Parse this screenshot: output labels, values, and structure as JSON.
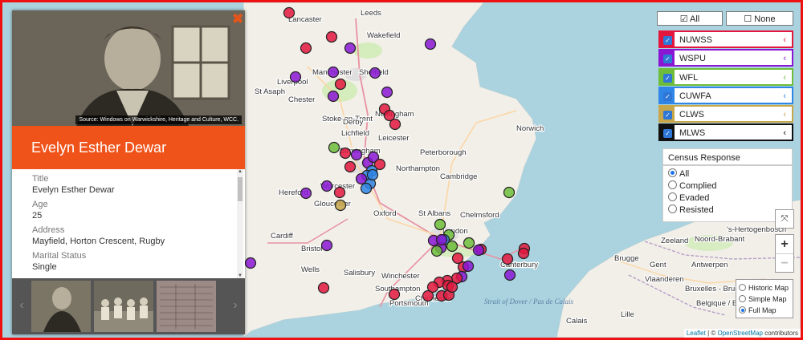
{
  "person": {
    "name": "Evelyn Esther Dewar",
    "photo_credit": "Source: Windows on Warwickshire, Heritage and Culture, WCC.",
    "close_icon": "close-x-icon",
    "fields": [
      {
        "label": "Title",
        "value": "Evelyn Esther Dewar"
      },
      {
        "label": "Age",
        "value": "25"
      },
      {
        "label": "Address",
        "value": "Mayfield, Horton Crescent, Rugby"
      },
      {
        "label": "Marital Status",
        "value": "Single"
      }
    ],
    "gallery_prev": "‹",
    "gallery_next": "›"
  },
  "filters": {
    "all_label": "☑ All",
    "none_label": "☐ None",
    "layers": [
      {
        "label": "NUWSS",
        "color": "#e3173e"
      },
      {
        "label": "WSPU",
        "color": "#8a16d4"
      },
      {
        "label": "WFL",
        "color": "#6dbd3a"
      },
      {
        "label": "CUWFA",
        "color": "#2f86e6"
      },
      {
        "label": "CLWS",
        "color": "#c8a64a"
      },
      {
        "label": "MLWS",
        "color": "#111111"
      }
    ],
    "chevron": "‹"
  },
  "census": {
    "title": "Census Response",
    "options": [
      "All",
      "Complied",
      "Evaded",
      "Resisted"
    ],
    "selected": "All"
  },
  "map_type": {
    "options": [
      "Historic Map",
      "Simple Map",
      "Full Map"
    ],
    "selected": "Full Map"
  },
  "zoom": {
    "in": "+",
    "out": "−",
    "fullscreen": "⤧"
  },
  "attribution": {
    "leaflet": "Leaflet",
    "sep": " | © ",
    "osm": "OpenStreetMap",
    "rest": " contributors"
  },
  "map_labels": [
    "Lancaster",
    "Leeds",
    "Wakefield",
    "Sheffield",
    "Manchester",
    "Liverpool",
    "Chester",
    "St Asaph",
    "Stoke-on-Trent",
    "Derby",
    "Nottingham",
    "Lichfield",
    "Leicester",
    "Peterborough",
    "Birmingham",
    "Norwich",
    "Cambridge",
    "Northampton",
    "Hereford",
    "Worcester",
    "Gloucester",
    "Oxford",
    "St Albans",
    "Chelmsford",
    "Cardiff",
    "Bristol",
    "Wells",
    "Salisbury",
    "Winchester",
    "Southampton",
    "Portsmouth",
    "Chichester",
    "Canterbury",
    "London",
    "Zeeland",
    "Noord-Brabant",
    "Antwerpen",
    "Vlaanderen",
    "Bruxelles - Brussel",
    "Belgique / België",
    "Lille",
    "Calais",
    "Gent",
    "'s-Hertogenbosch",
    "Brugge"
  ],
  "sea_labels": [
    "Strait of Dover / Pas de Calais"
  ],
  "region_labels": [
    "Belgique / België"
  ]
}
